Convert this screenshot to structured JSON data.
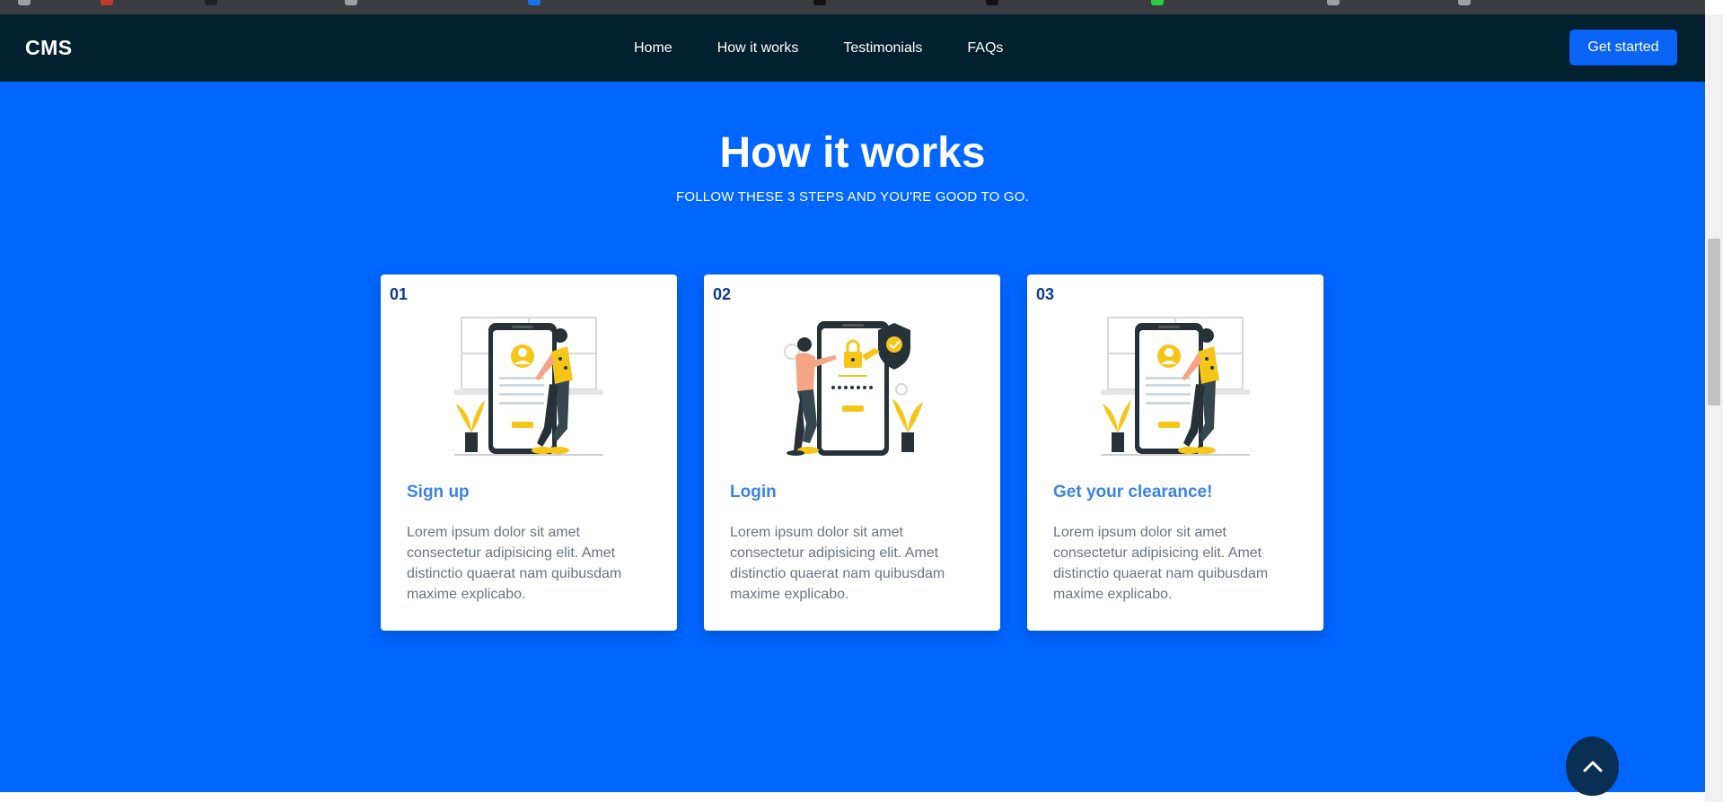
{
  "navbar": {
    "brand": "CMS",
    "links": [
      "Home",
      "How it works",
      "Testimonials",
      "FAQs"
    ],
    "cta_label": "Get started"
  },
  "section": {
    "title": "How it works",
    "subtitle": "FOLLOW THESE 3 STEPS AND YOU'RE GOOD TO GO."
  },
  "steps": [
    {
      "number": "01",
      "title": "Sign up",
      "text": "Lorem ipsum dolor sit amet consectetur adipisicing elit. Amet distinctio quaerat nam quibusdam maxime explicabo.",
      "illustration": "person-signing-up-on-phone"
    },
    {
      "number": "02",
      "title": "Login",
      "text": "Lorem ipsum dolor sit amet consectetur adipisicing elit. Amet distinctio quaerat nam quibusdam maxime explicabo.",
      "illustration": "person-unlocking-phone"
    },
    {
      "number": "03",
      "title": "Get your clearance!",
      "text": "Lorem ipsum dolor sit amet consectetur adipisicing elit. Amet distinctio quaerat nam quibusdam maxime explicabo.",
      "illustration": "person-signing-up-on-phone"
    }
  ],
  "icons": {
    "scroll_top": "chevron-up-icon"
  },
  "colors": {
    "navbar_bg": "#03202e",
    "section_bg": "#0066ff",
    "cta_bg": "#0a64f6",
    "step_number": "#0d3a8c",
    "step_title": "#3b82e6",
    "body_text": "#6b7280",
    "illustration_accent": "#f5c518",
    "scroll_top_bg": "#0a2f55"
  }
}
